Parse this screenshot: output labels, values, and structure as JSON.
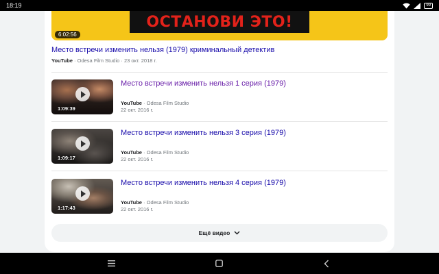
{
  "status_bar": {
    "time": "18:19",
    "battery": "99"
  },
  "hero": {
    "banner_text": "ОСТАНОВИ ЭТО!",
    "duration": "6:02:56"
  },
  "main_result": {
    "title": "Место встречи изменить нельзя (1979) криминальный детектив",
    "source": "YouTube",
    "meta": " · Odesa Film Studio · 23 окт. 2018 г."
  },
  "videos": [
    {
      "title": "Место встречи изменить нельзя 1 серия (1979)",
      "duration": "1:09:39",
      "source": "YouTube",
      "channel": " · Odesa Film Studio",
      "date": "22 окт. 2016 г."
    },
    {
      "title": "Место встречи изменить нельзя 3 серия (1979)",
      "duration": "1:09:17",
      "source": "YouTube",
      "channel": " · Odesa Film Studio",
      "date": "22 окт. 2016 г."
    },
    {
      "title": "Место встречи изменить нельзя 4 серия (1979)",
      "duration": "1:17:43",
      "source": "YouTube",
      "channel": " · Odesa Film Studio",
      "date": "22 окт. 2016 г."
    }
  ],
  "more_button": {
    "label": "Ещё видео"
  },
  "icons": {
    "more": "chevron-down-icon",
    "nav": [
      "menu-icon",
      "home-icon",
      "back-icon"
    ]
  },
  "colors": {
    "link": "#1a0dab",
    "visited_link": "#681da8",
    "hero_background": "#f5c518",
    "hero_text": "#e3221a"
  }
}
